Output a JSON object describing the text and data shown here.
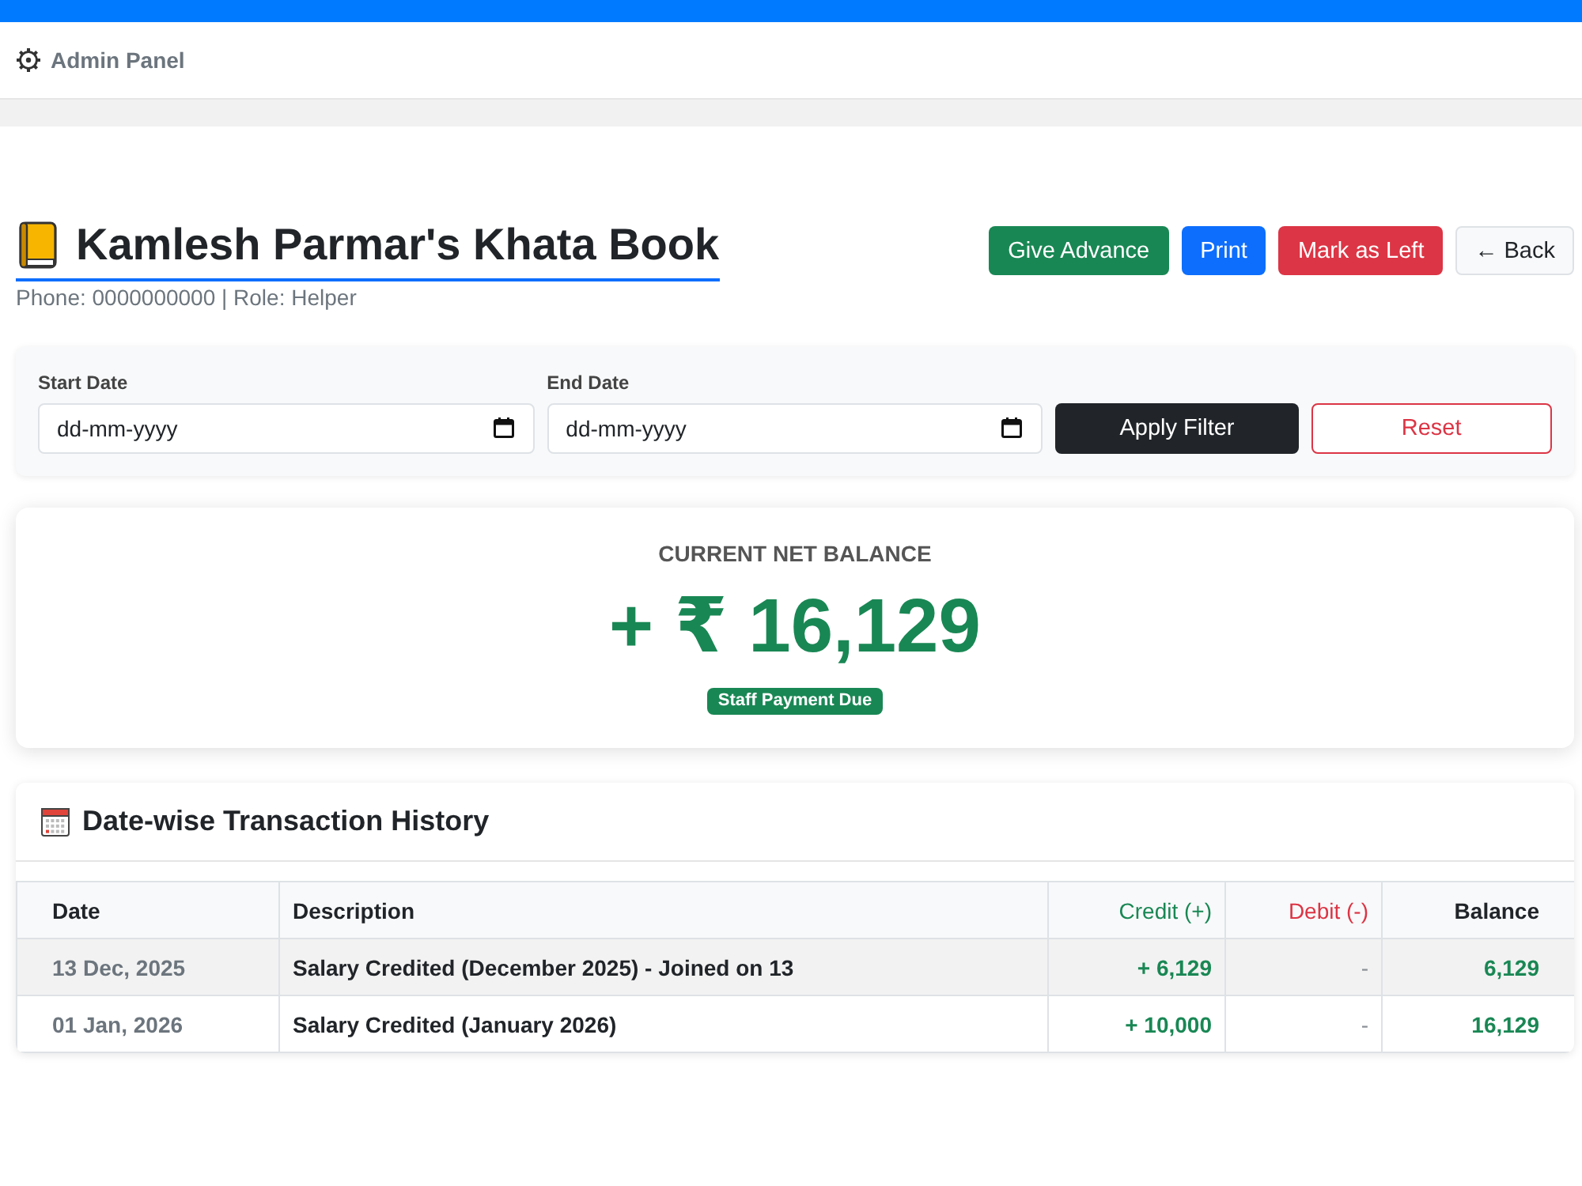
{
  "navbar": {
    "brand": "Admin Panel"
  },
  "page_header": {
    "title": "Kamlesh Parmar's Khata Book",
    "subtitle": "Phone: 0000000000 | Role: Helper",
    "actions": [
      {
        "label": "Give Advance",
        "kind": "success"
      },
      {
        "label": "Print",
        "kind": "primary"
      },
      {
        "label": "Mark as Left",
        "kind": "danger"
      },
      {
        "label": "← Back",
        "kind": "light"
      }
    ]
  },
  "filter": {
    "fields": [
      {
        "label": "Start Date",
        "placeholder": "dd-mm-yyyy"
      },
      {
        "label": "End Date",
        "placeholder": "dd-mm-yyyy"
      }
    ],
    "buttons": [
      {
        "label": "Apply Filter",
        "kind": "dark"
      },
      {
        "label": "Reset",
        "kind": "outline-danger"
      }
    ]
  },
  "balance": {
    "label": "CURRENT NET BALANCE",
    "amount": "+ ₹ 16,129",
    "badge": "Staff Payment Due"
  },
  "history": {
    "title": "Date-wise Transaction History",
    "columns": [
      {
        "label": "Date",
        "kind": "date"
      },
      {
        "label": "Description",
        "kind": "description"
      },
      {
        "label": "Credit (+)",
        "kind": "credit"
      },
      {
        "label": "Debit (-)",
        "kind": "debit"
      },
      {
        "label": "Balance",
        "kind": "balance"
      }
    ],
    "rows": [
      {
        "cells": [
          "13 Dec, 2025",
          "Salary Credited (December 2025) - Joined on 13",
          "+ 6,129",
          "-",
          "6,129"
        ]
      },
      {
        "cells": [
          "01 Jan, 2026",
          "Salary Credited (January 2026)",
          "+ 10,000",
          "-",
          "16,129"
        ]
      }
    ]
  }
}
